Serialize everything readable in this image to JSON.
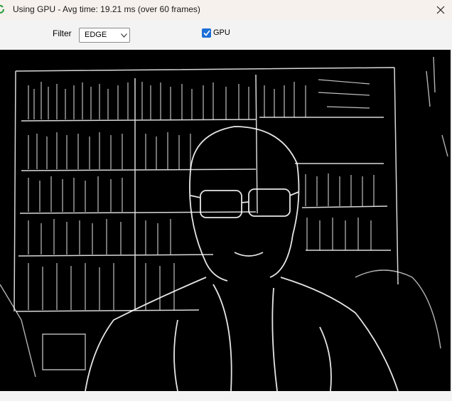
{
  "window": {
    "title": "Using GPU - Avg time: 19.21 ms (over 60 frames)",
    "app_icon": "refresh-arrows-icon",
    "close_icon": "close-icon"
  },
  "toolbar": {
    "filter_label": "Filter",
    "filter_value": "EDGE",
    "gpu_checked": true,
    "gpu_label": "GPU"
  },
  "colors": {
    "accent": "#1b6fd6",
    "icon_green": "#2e9e44",
    "video_background": "#000000",
    "edge_lines": "#ffffff"
  },
  "video": {
    "filter_effect": "edge detection (white edges on black)"
  }
}
